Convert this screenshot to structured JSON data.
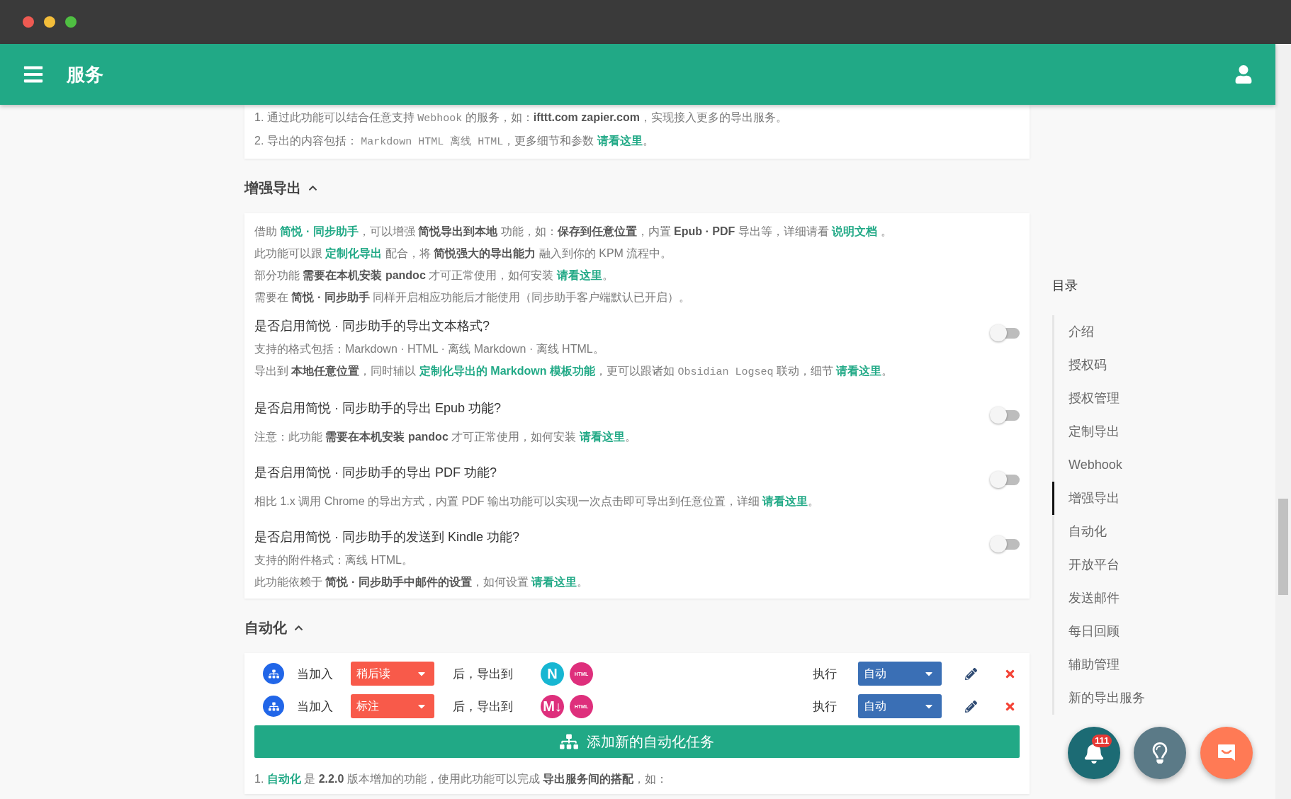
{
  "header": {
    "title": "服务"
  },
  "intro_card": {
    "lines": [
      [
        {
          "kind": "plain",
          "text": "1. 通过此功能可以结合任意支持 "
        },
        {
          "kind": "code",
          "text": "Webhook"
        },
        {
          "kind": "plain",
          "text": " 的服务，如："
        },
        {
          "kind": "bold",
          "text": "ifttt.com zapier.com"
        },
        {
          "kind": "plain",
          "text": "，实现接入更多的导出服务。"
        }
      ],
      [
        {
          "kind": "plain",
          "text": "2. 导出的内容包括： "
        },
        {
          "kind": "code",
          "text": "Markdown HTML 离线 HTML"
        },
        {
          "kind": "plain",
          "text": "，更多细节和参数 "
        },
        {
          "kind": "link",
          "text": "请看这里"
        },
        {
          "kind": "plain",
          "text": "。"
        }
      ]
    ]
  },
  "enhanced_export": {
    "title": "增强导出",
    "expanded": true,
    "intro": [
      [
        {
          "kind": "plain",
          "text": "借助 "
        },
        {
          "kind": "link",
          "text": "简悦 · 同步助手"
        },
        {
          "kind": "plain",
          "text": "，可以增强 "
        },
        {
          "kind": "bold",
          "text": "简悦导出到本地"
        },
        {
          "kind": "plain",
          "text": " 功能，如："
        },
        {
          "kind": "bold",
          "text": "保存到任意位置"
        },
        {
          "kind": "plain",
          "text": "，内置 "
        },
        {
          "kind": "bold",
          "text": "Epub · PDF"
        },
        {
          "kind": "plain",
          "text": " 导出等，详细请看 "
        },
        {
          "kind": "link",
          "text": "说明文档"
        },
        {
          "kind": "plain",
          "text": " 。"
        }
      ],
      [
        {
          "kind": "plain",
          "text": "此功能可以跟 "
        },
        {
          "kind": "link",
          "text": "定制化导出"
        },
        {
          "kind": "plain",
          "text": " 配合，将 "
        },
        {
          "kind": "bold",
          "text": "简悦强大的导出能力"
        },
        {
          "kind": "plain",
          "text": " 融入到你的 KPM 流程中。"
        }
      ],
      [
        {
          "kind": "plain",
          "text": "部分功能 "
        },
        {
          "kind": "bold",
          "text": "需要在本机安装 pandoc"
        },
        {
          "kind": "plain",
          "text": " 才可正常使用，如何安装 "
        },
        {
          "kind": "link",
          "text": "请看这里"
        },
        {
          "kind": "plain",
          "text": "。"
        }
      ],
      [
        {
          "kind": "plain",
          "text": "需要在 "
        },
        {
          "kind": "bold",
          "text": "简悦 · 同步助手"
        },
        {
          "kind": "plain",
          "text": " 同样开启相应功能后才能使用（同步助手客户端默认已开启）。"
        }
      ]
    ],
    "options": [
      {
        "question": "是否启用简悦 · 同步助手的导出文本格式?",
        "on": false,
        "notes": [
          [
            {
              "kind": "plain",
              "text": "支持的格式包括：Markdown · HTML · 离线 Markdown · 离线 HTML。"
            }
          ],
          [
            {
              "kind": "plain",
              "text": "导出到 "
            },
            {
              "kind": "bold",
              "text": "本地任意位置"
            },
            {
              "kind": "plain",
              "text": "，同时辅以 "
            },
            {
              "kind": "link",
              "text": "定制化导出的 Markdown 模板功能"
            },
            {
              "kind": "plain",
              "text": "，更可以跟诸如 "
            },
            {
              "kind": "code",
              "text": "Obsidian Logseq"
            },
            {
              "kind": "plain",
              "text": " 联动，细节 "
            },
            {
              "kind": "link",
              "text": "请看这里"
            },
            {
              "kind": "plain",
              "text": "。"
            }
          ]
        ]
      },
      {
        "question": "是否启用简悦 · 同步助手的导出 Epub 功能?",
        "on": false,
        "notes": [
          [
            {
              "kind": "plain",
              "text": "注意：此功能 "
            },
            {
              "kind": "bold",
              "text": "需要在本机安装 pandoc"
            },
            {
              "kind": "plain",
              "text": " 才可正常使用，如何安装 "
            },
            {
              "kind": "link",
              "text": "请看这里"
            },
            {
              "kind": "plain",
              "text": "。"
            }
          ]
        ]
      },
      {
        "question": "是否启用简悦 · 同步助手的导出 PDF 功能?",
        "on": false,
        "notes": [
          [
            {
              "kind": "plain",
              "text": "相比 1.x 调用 Chrome 的导出方式，内置 PDF 输出功能可以实现一次点击即可导出到任意位置，详细 "
            },
            {
              "kind": "link",
              "text": "请看这里"
            },
            {
              "kind": "plain",
              "text": "。"
            }
          ]
        ]
      },
      {
        "question": "是否启用简悦 · 同步助手的发送到 Kindle 功能?",
        "on": false,
        "notes": [
          [
            {
              "kind": "plain",
              "text": "支持的附件格式：离线 HTML。"
            }
          ],
          [
            {
              "kind": "plain",
              "text": "此功能依赖于 "
            },
            {
              "kind": "bold",
              "text": "简悦 · 同步助手中邮件的设置"
            },
            {
              "kind": "plain",
              "text": "，如何设置 "
            },
            {
              "kind": "link",
              "text": "请看这里"
            },
            {
              "kind": "plain",
              "text": "。"
            }
          ]
        ]
      }
    ]
  },
  "automation": {
    "title": "自动化",
    "expanded": true,
    "tasks": [
      {
        "trigger_label": "当加入",
        "source": "稍后读",
        "middle_label": "后，导出到",
        "targets": [
          {
            "label": "N",
            "color": "#17b6d2"
          },
          {
            "label": "HTML",
            "color": "#de2f7c"
          }
        ],
        "run_label": "执行",
        "mode": "自动"
      },
      {
        "trigger_label": "当加入",
        "source": "标注",
        "middle_label": "后，导出到",
        "targets": [
          {
            "label": "M↓",
            "color": "#de2f7c"
          },
          {
            "label": "HTML",
            "color": "#de2f7c"
          }
        ],
        "run_label": "执行",
        "mode": "自动"
      }
    ],
    "add_button": "添加新的自动化任务",
    "notes": [
      [
        {
          "kind": "plain",
          "text": "1. "
        },
        {
          "kind": "link",
          "text": "自动化"
        },
        {
          "kind": "plain",
          "text": " 是 "
        },
        {
          "kind": "bold",
          "text": "2.2.0"
        },
        {
          "kind": "plain",
          "text": " 版本增加的功能，使用此功能可以完成 "
        },
        {
          "kind": "bold",
          "text": "导出服务间的搭配"
        },
        {
          "kind": "plain",
          "text": "，如："
        }
      ]
    ]
  },
  "toc": {
    "title": "目录",
    "items": [
      {
        "label": "介绍",
        "selected": false
      },
      {
        "label": "授权码",
        "selected": false
      },
      {
        "label": "授权管理",
        "selected": false
      },
      {
        "label": "定制导出",
        "selected": false
      },
      {
        "label": "Webhook",
        "selected": false
      },
      {
        "label": "增强导出",
        "selected": true
      },
      {
        "label": "自动化",
        "selected": false
      },
      {
        "label": "开放平台",
        "selected": false
      },
      {
        "label": "发送邮件",
        "selected": false
      },
      {
        "label": "每日回顾",
        "selected": false
      },
      {
        "label": "辅助管理",
        "selected": false
      },
      {
        "label": "新的导出服务",
        "selected": false
      }
    ]
  },
  "notifications": {
    "count": "111"
  }
}
